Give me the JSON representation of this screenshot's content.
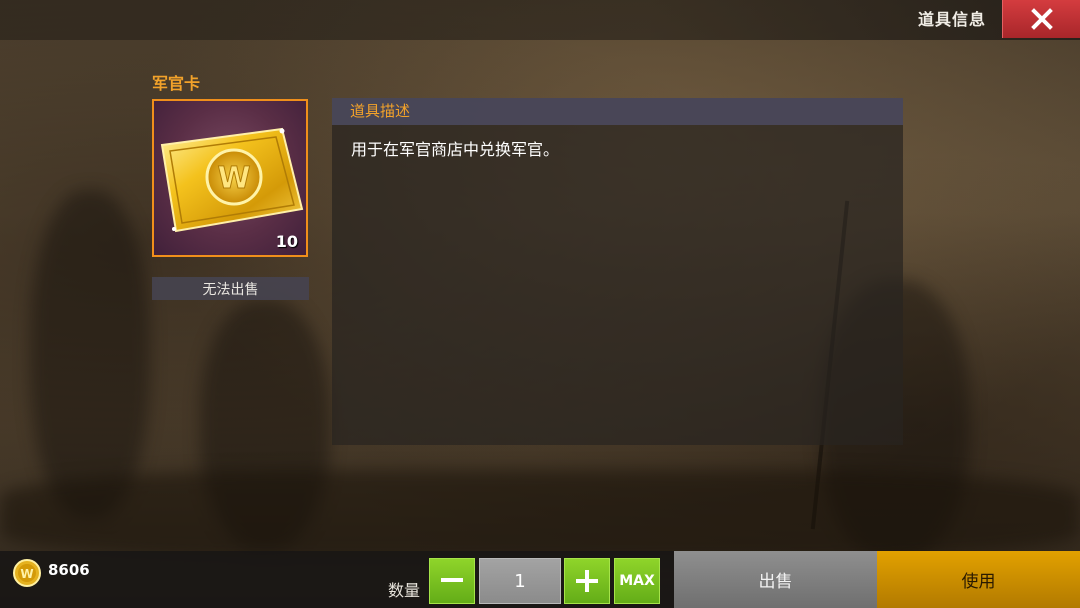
{
  "header": {
    "title": "道具信息"
  },
  "item": {
    "name": "军官卡",
    "count": "10",
    "sell_status": "无法出售"
  },
  "description": {
    "header": "道具描述",
    "text": "用于在军官商店中兑换军官。"
  },
  "currency": {
    "amount": "8606"
  },
  "quantity": {
    "label": "数量",
    "value": "1",
    "minus_label": "—",
    "plus_label": "+",
    "max_label": "MAX"
  },
  "actions": {
    "sell_label": "出售",
    "use_label": "使用"
  },
  "colors": {
    "accent_orange": "#f2a22a",
    "close_red": "#c7383b",
    "green_button": "#7cc522",
    "use_gold": "#d49400"
  },
  "icons": [
    "close-icon",
    "gold-coin-icon",
    "officer-card-icon"
  ]
}
